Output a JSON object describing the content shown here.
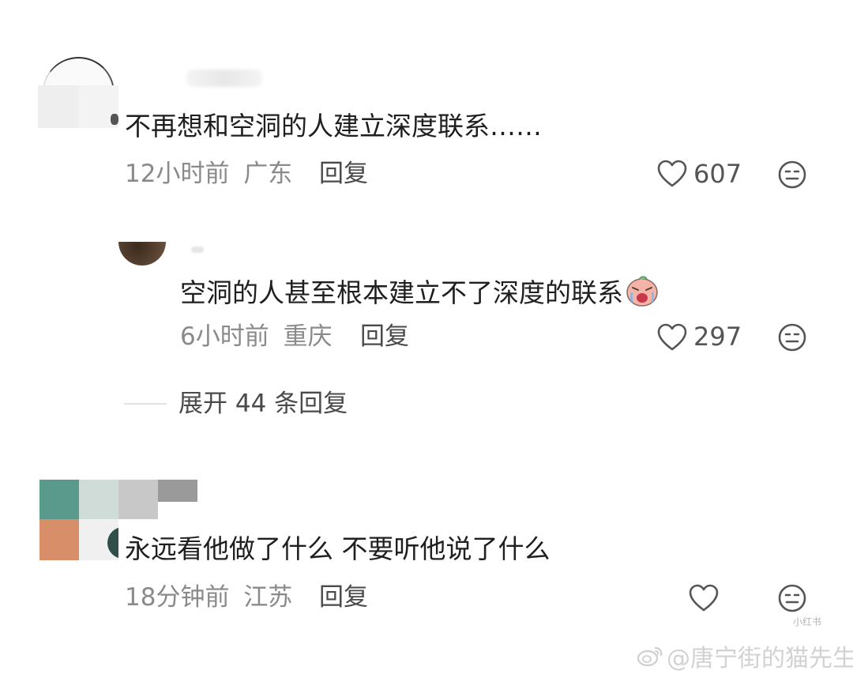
{
  "comments": [
    {
      "text": "不再想和空洞的人建立深度联系……",
      "time": "12小时前",
      "location": "广东",
      "reply_label": "回复",
      "likes": "607"
    },
    {
      "text": "空洞的人甚至根本建立不了深度的联系",
      "time": "6小时前",
      "location": "重庆",
      "reply_label": "回复",
      "likes": "297"
    },
    {
      "text": "永远看他做了什么 不要听他说了什么",
      "time": "18分钟前",
      "location": "江苏",
      "reply_label": "回复",
      "likes": ""
    }
  ],
  "expand_replies": "展开 44 条回复",
  "watermark": "@唐宁街的猫先生",
  "watermark_small": "小红书",
  "icons": {
    "like": "heart-outline-icon",
    "dislike": "neutral-face-icon",
    "sticker": "crying-face-sticker-icon",
    "weibo": "weibo-logo-icon"
  },
  "colors": {
    "text": "#1f1f1f",
    "meta": "#8a8a8a",
    "icon": "#555555"
  }
}
